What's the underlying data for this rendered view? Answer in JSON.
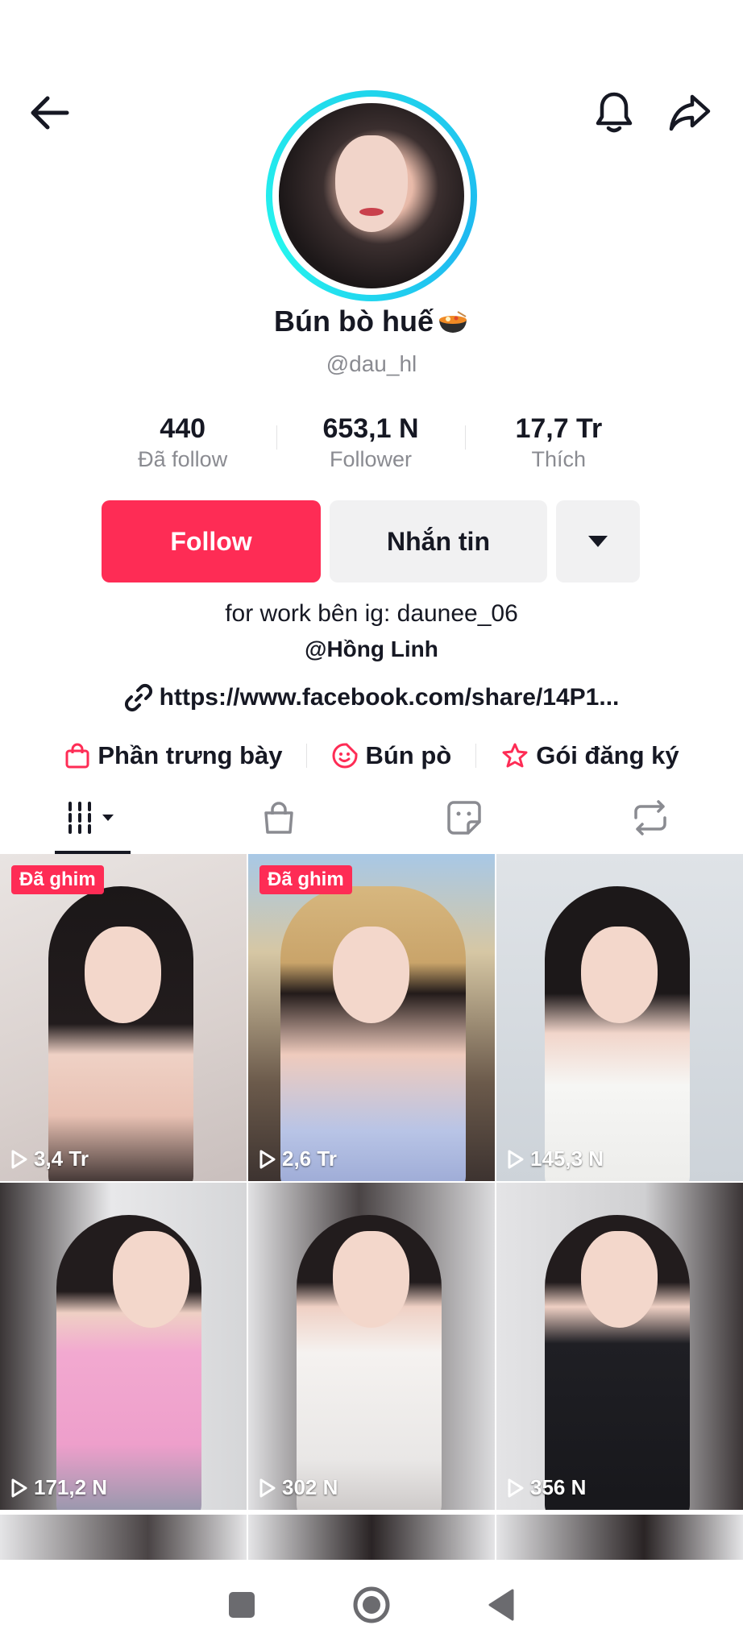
{
  "profile": {
    "display_name": "Bún bò huế",
    "username": "@dau_hl",
    "bio": "for work bên ig: daunee_06",
    "mention": "@Hồng Linh",
    "link": "https://www.facebook.com/share/14P1..."
  },
  "stats": [
    {
      "value": "440",
      "label": "Đã follow"
    },
    {
      "value": "653,1 N",
      "label": "Follower"
    },
    {
      "value": "17,7 Tr",
      "label": "Thích"
    }
  ],
  "actions": {
    "follow_label": "Follow",
    "message_label": "Nhắn tin"
  },
  "chips": [
    {
      "label": "Phần trưng bày",
      "icon": "shopping-bag-icon"
    },
    {
      "label": "Bún pò",
      "icon": "sticker-icon"
    },
    {
      "label": "Gói đăng ký",
      "icon": "star-icon"
    }
  ],
  "tabs": [
    "videos-grid-icon",
    "shop-bag-icon",
    "favorites-sticker-icon",
    "repost-icon"
  ],
  "videos": [
    {
      "views": "3,4 Tr",
      "pinned": "Đã ghim"
    },
    {
      "views": "2,6 Tr",
      "pinned": "Đã ghim"
    },
    {
      "views": "145,3 N",
      "pinned": ""
    },
    {
      "views": "171,2 N",
      "pinned": ""
    },
    {
      "views": "302 N",
      "pinned": ""
    },
    {
      "views": "356 N",
      "pinned": ""
    }
  ],
  "colors": {
    "accent": "#fe2c55",
    "ring": "#20d5ec",
    "text": "#161823",
    "muted": "#8a8b91"
  }
}
